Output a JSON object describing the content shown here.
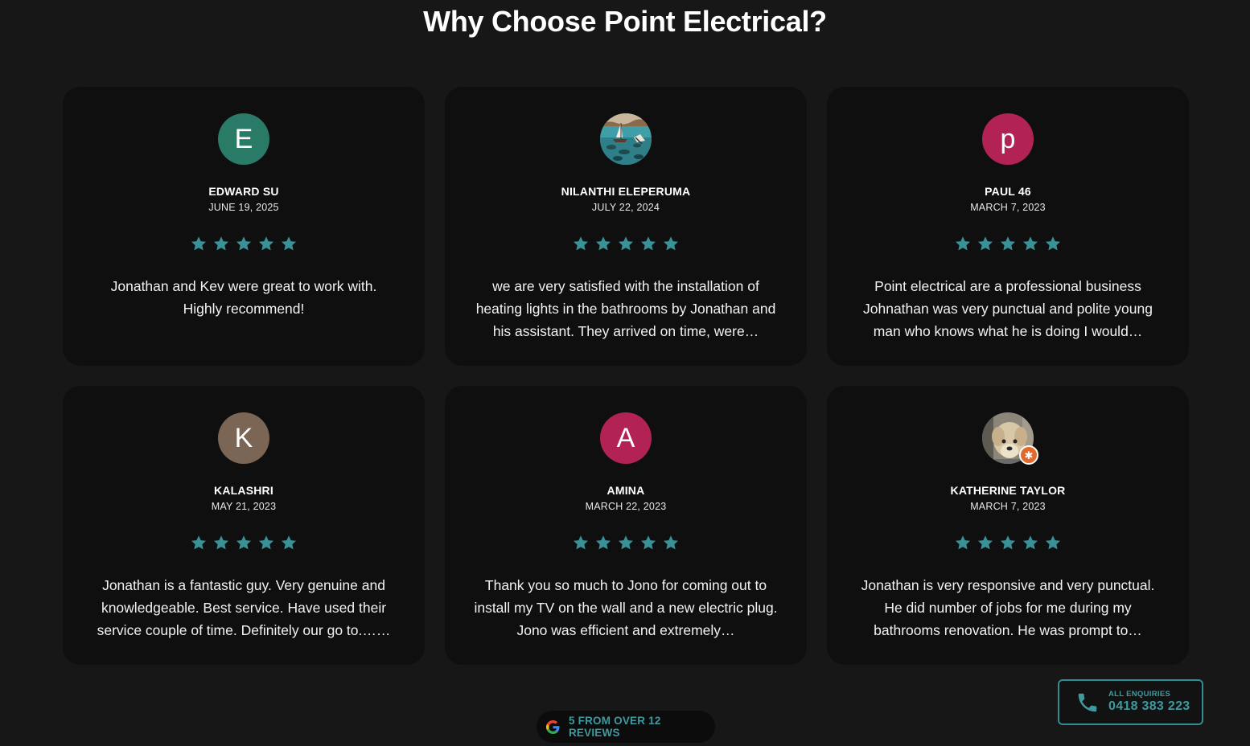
{
  "section": {
    "title": "Why Choose Point Electrical?"
  },
  "colors": {
    "background": "#171717",
    "card": "#0f0f0f",
    "accent": "#3f9a9f",
    "star": "#3a9297"
  },
  "reviews": [
    {
      "name": "EDWARD SU",
      "date": "JUNE 19, 2025",
      "rating": 5,
      "initial": "E",
      "avatar_color": "#2a7a68",
      "text": "Jonathan and Kev were great to work with. Highly recommend!"
    },
    {
      "name": "NILANTHI ELEPERUMA",
      "date": "JULY 22, 2024",
      "rating": 5,
      "avatar": "photo-sailboat",
      "text": "we are very satisfied with the installation of heating lights in the bathrooms by Jonathan and his assistant. They arrived on time, were…"
    },
    {
      "name": "PAUL 46",
      "date": "MARCH 7, 2023",
      "rating": 5,
      "initial": "p",
      "avatar_color": "#b32255",
      "text": "Point electrical are a professional business Johnathan was very punctual and polite young man who knows what he is doing I would…"
    },
    {
      "name": "KALASHRI",
      "date": "MAY 21, 2023",
      "rating": 5,
      "initial": "K",
      "avatar_color": "#7b6554",
      "text": "Jonathan is a fantastic guy. Very genuine and knowledgeable. Best service. Have used their service couple of time. Definitely our go to.……"
    },
    {
      "name": "AMINA",
      "date": "MARCH 22, 2023",
      "rating": 5,
      "initial": "A",
      "avatar_color": "#b32255",
      "text": "Thank you so much to Jono for coming out to install my TV on the wall and a new electric plug. Jono was efficient and extremely…"
    },
    {
      "name": "KATHERINE TAYLOR",
      "date": "MARCH 7, 2023",
      "rating": 5,
      "avatar": "photo-dog",
      "badge": "local-guide-badge",
      "text": "Jonathan is very responsive and very punctual. He did number of jobs for me during my bathrooms renovation. He was prompt to…"
    }
  ],
  "summary": {
    "icon": "google-icon",
    "text": "5 FROM OVER 12 REVIEWS"
  },
  "enquiry": {
    "icon": "phone-icon",
    "label": "ALL ENQUIRIES",
    "number": "0418 383 223"
  }
}
